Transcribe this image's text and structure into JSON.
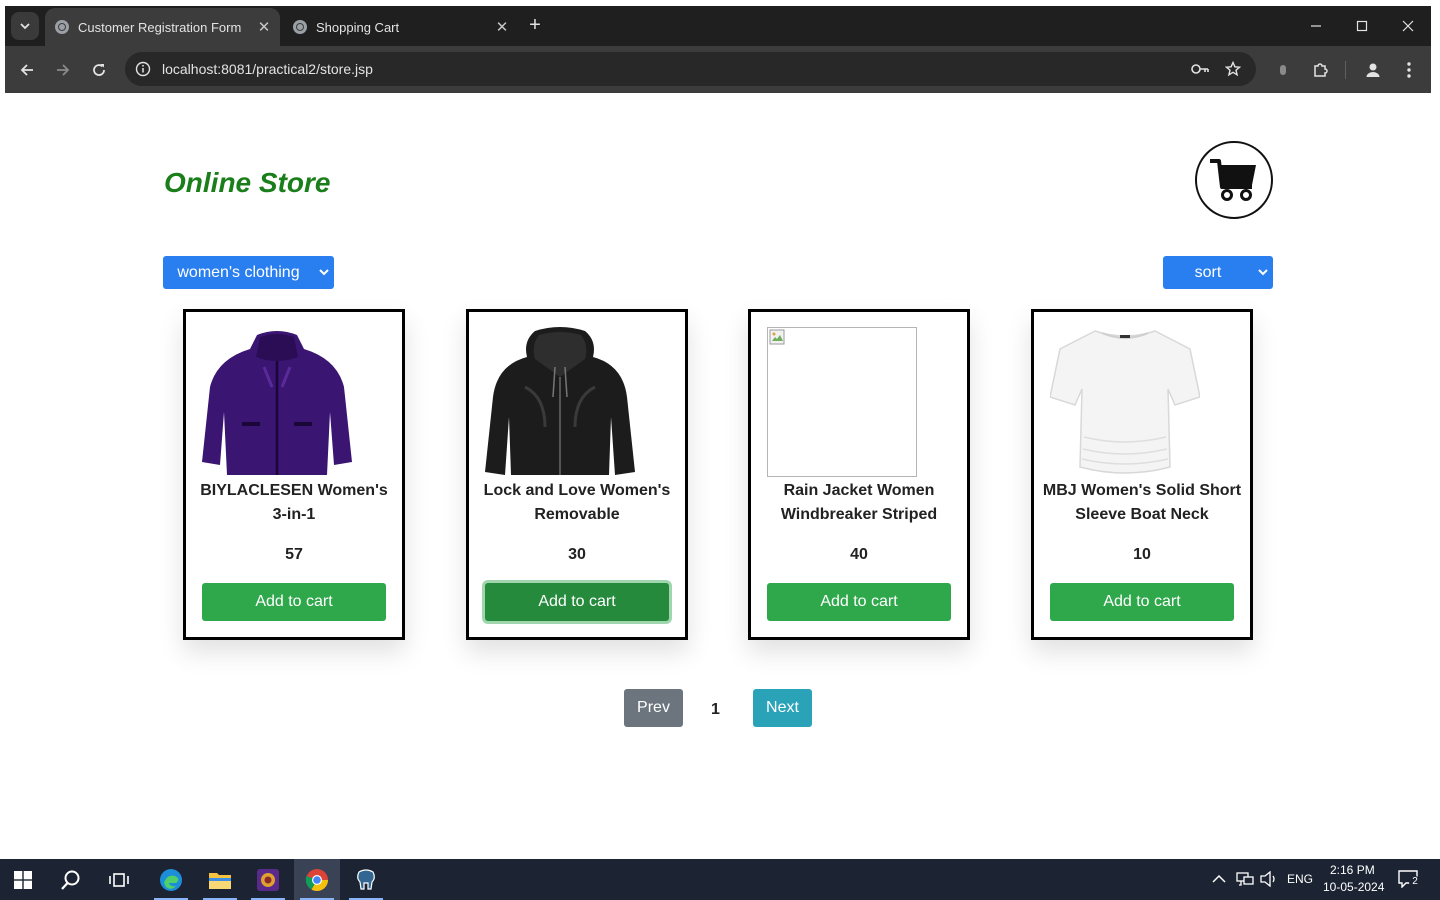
{
  "browser": {
    "tabs": [
      {
        "title": "Customer Registration Form",
        "active": true
      },
      {
        "title": "Shopping Cart",
        "active": false
      }
    ],
    "url": "localhost:8081/practical2/store.jsp"
  },
  "store": {
    "title": "Online Store",
    "category_filter": "women's clothing",
    "sort_label": "sort",
    "products": [
      {
        "name": "BIYLACLESEN Women's 3-in-1",
        "quantity": "57",
        "button": "Add to cart",
        "image": "purple-jacket"
      },
      {
        "name": "Lock and Love Women's Removable",
        "quantity": "30",
        "button": "Add to cart",
        "image": "black-leather-jacket"
      },
      {
        "name": "Rain Jacket Women Windbreaker Striped",
        "quantity": "40",
        "button": "Add to cart",
        "image": "broken-image"
      },
      {
        "name": "MBJ Women's Solid Short Sleeve Boat Neck",
        "quantity": "10",
        "button": "Add to cart",
        "image": "white-tshirt"
      }
    ],
    "pagination": {
      "prev": "Prev",
      "current": "1",
      "next": "Next"
    }
  },
  "colors": {
    "title_green": "#1a7f1a",
    "select_blue": "#2a7ff0",
    "add_button_green": "#2ea84a",
    "prev_gray": "#6c757d",
    "next_teal": "#2aa2b8"
  },
  "taskbar": {
    "language": "ENG",
    "time": "2:16 PM",
    "date": "10-05-2024",
    "notification_count": "2"
  }
}
